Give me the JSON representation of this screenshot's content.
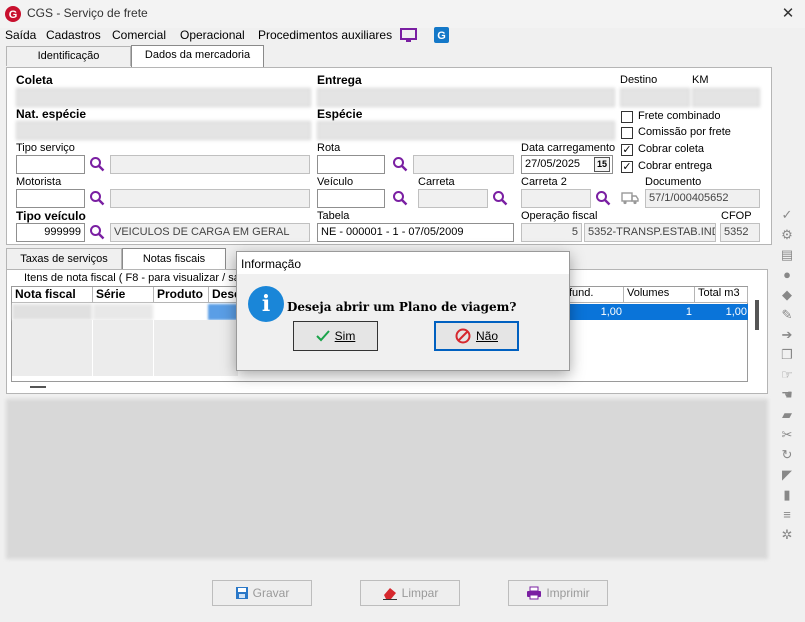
{
  "window": {
    "title": "CGS - Serviço de frete"
  },
  "menu": {
    "items": [
      "Saída",
      "Cadastros",
      "Comercial",
      "Operacional",
      "Procedimentos auxiliares"
    ]
  },
  "tabs_main": [
    "Identificação",
    "Dados da mercadoria"
  ],
  "form": {
    "coleta_label": "Coleta",
    "entrega_label": "Entrega",
    "destino_label": "Destino",
    "km_label": "KM",
    "nat_especie_label": "Nat. espécie",
    "especie_label": "Espécie",
    "tipo_servico_label": "Tipo serviço",
    "rota_label": "Rota",
    "data_carregamento_label": "Data carregamento",
    "data_carregamento_value": "27/05/2025",
    "motorista_label": "Motorista",
    "veiculo_label": "Veículo",
    "carreta_label": "Carreta",
    "carreta2_label": "Carreta 2",
    "documento_label": "Documento",
    "documento_value": "57/1/000405652",
    "tipo_veiculo_label": "Tipo veículo",
    "tipo_veiculo_code": "999999",
    "tipo_veiculo_desc": "VEICULOS DE CARGA EM GERAL",
    "tabela_label": "Tabela",
    "tabela_value": "NE - 000001 - 1 - 07/05/2009",
    "operacao_fiscal_label": "Operação fiscal",
    "operacao_fiscal_code": "5",
    "operacao_fiscal_desc": "5352-TRANSP.ESTAB.IND",
    "cfop_label": "CFOP",
    "cfop_value": "5352",
    "calendar_button": "15"
  },
  "checkboxes": [
    {
      "label": "Frete combinado",
      "checked": false
    },
    {
      "label": "Comissão por frete",
      "checked": false
    },
    {
      "label": "Cobrar coleta",
      "checked": true
    },
    {
      "label": "Cobrar entrega",
      "checked": true
    }
  ],
  "tabs_lower": [
    "Taxas de serviços",
    "Notas fiscais"
  ],
  "items_group_label": "Itens de nota fiscal ( F8 - para visualizar / sair",
  "grid": {
    "headers": [
      "Nota fiscal",
      "Série",
      "Produto",
      "Desc"
    ],
    "headers_right": [
      "fund.",
      "Volumes",
      "Total m3"
    ],
    "selected_row_right": [
      "1,00",
      "1",
      "1,00"
    ]
  },
  "buttons": {
    "gravar": "Gravar",
    "limpar": "Limpar",
    "imprimir": "Imprimir"
  },
  "dialog": {
    "title": "Informação",
    "message": "Deseja abrir um Plano de viagem?",
    "yes": "Sim",
    "no": "Não",
    "icon_letter": "i"
  }
}
